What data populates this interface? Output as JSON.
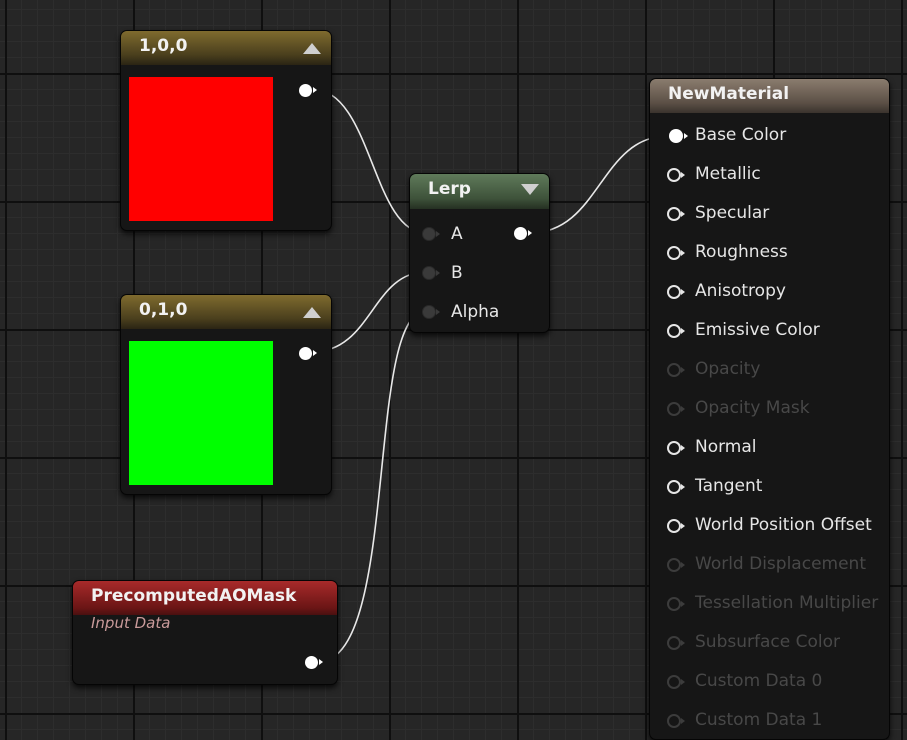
{
  "const_red": {
    "title": "1,0,0",
    "color": "#ff0000"
  },
  "const_green": {
    "title": "0,1,0",
    "color": "#00ff00"
  },
  "lerp": {
    "title": "Lerp",
    "inputs": [
      "A",
      "B",
      "Alpha"
    ]
  },
  "ao_mask": {
    "title": "PrecomputedAOMask",
    "subtitle": "Input Data"
  },
  "material": {
    "title": "NewMaterial",
    "inputs": [
      {
        "label": "Base Color",
        "enabled": true,
        "connected": true
      },
      {
        "label": "Metallic",
        "enabled": true,
        "connected": false
      },
      {
        "label": "Specular",
        "enabled": true,
        "connected": false
      },
      {
        "label": "Roughness",
        "enabled": true,
        "connected": false
      },
      {
        "label": "Anisotropy",
        "enabled": true,
        "connected": false
      },
      {
        "label": "Emissive Color",
        "enabled": true,
        "connected": false
      },
      {
        "label": "Opacity",
        "enabled": false,
        "connected": false
      },
      {
        "label": "Opacity Mask",
        "enabled": false,
        "connected": false
      },
      {
        "label": "Normal",
        "enabled": true,
        "connected": false
      },
      {
        "label": "Tangent",
        "enabled": true,
        "connected": false
      },
      {
        "label": "World Position Offset",
        "enabled": true,
        "connected": false
      },
      {
        "label": "World Displacement",
        "enabled": false,
        "connected": false
      },
      {
        "label": "Tessellation Multiplier",
        "enabled": false,
        "connected": false
      },
      {
        "label": "Subsurface Color",
        "enabled": false,
        "connected": false
      },
      {
        "label": "Custom Data 0",
        "enabled": false,
        "connected": false
      },
      {
        "label": "Custom Data 1",
        "enabled": false,
        "connected": false
      }
    ]
  },
  "colors": {
    "wire": "#e8e8e8",
    "grid_bg": "#262626"
  }
}
